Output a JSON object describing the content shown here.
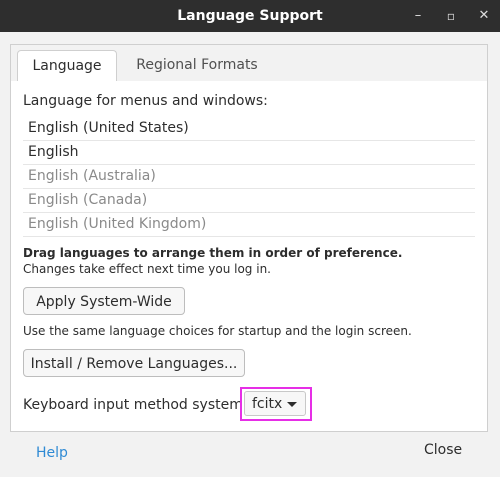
{
  "window": {
    "title": "Language Support",
    "controls": {
      "minimize": "–",
      "maximize": "▫",
      "close": "✕"
    }
  },
  "tabs": [
    {
      "label": "Language",
      "active": true
    },
    {
      "label": "Regional Formats",
      "active": false
    }
  ],
  "language_tab": {
    "list_label": "Language for menus and windows:",
    "languages": [
      {
        "label": "English (United States)",
        "enabled": true
      },
      {
        "label": "English",
        "enabled": true
      },
      {
        "label": "English (Australia)",
        "enabled": false
      },
      {
        "label": "English (Canada)",
        "enabled": false
      },
      {
        "label": "English (United Kingdom)",
        "enabled": false
      }
    ],
    "drag_hint": "Drag languages to arrange them in order of preference.",
    "changes_hint": "Changes take effect next time you log in.",
    "apply_button": "Apply System-Wide",
    "apply_hint": "Use the same language choices for startup and the login screen.",
    "install_button": "Install / Remove Languages...",
    "keyboard_label": "Keyboard input method system:",
    "keyboard_value": "fcitx"
  },
  "footer": {
    "help_label": "Help",
    "close_label": "Close"
  },
  "colors": {
    "titlebar": "#2e2e2e",
    "link": "#2f8ad4",
    "highlight_box": "#e62ee6"
  }
}
